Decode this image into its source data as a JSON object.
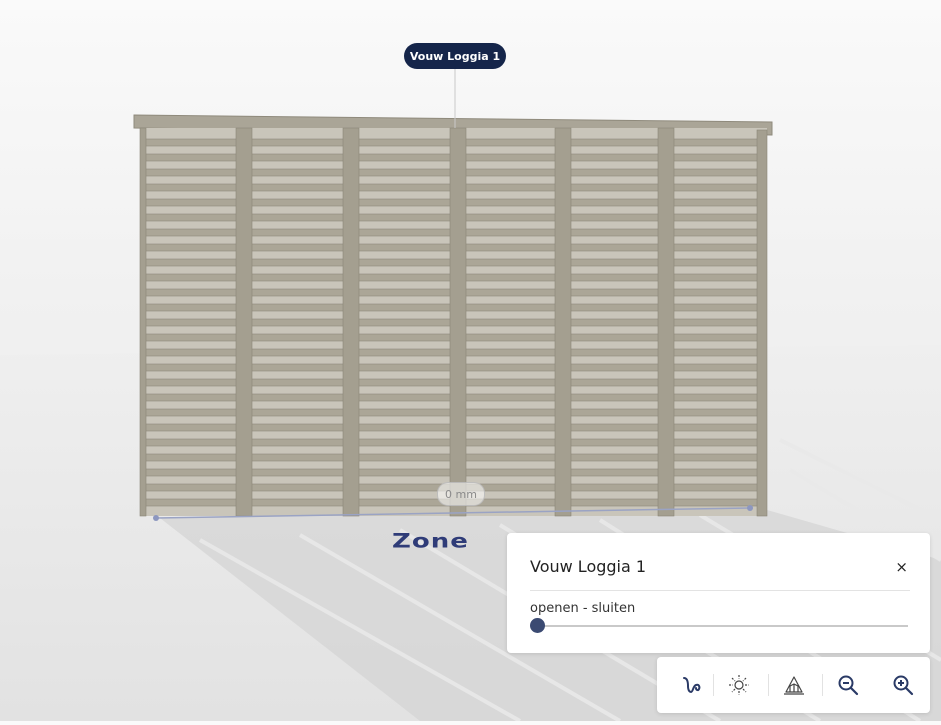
{
  "scene": {
    "object_tag": "Vouw Loggia 1",
    "measure_label": "0 mm",
    "zone_label": "Zone"
  },
  "panel": {
    "title": "Vouw Loggia 1",
    "close_label": "×",
    "slider_label": "openen - sluiten",
    "slider_value": 0
  },
  "toolbar": {
    "icons": [
      "curve-tool-icon",
      "sun-icon",
      "house-view-icon",
      "zoom-out-icon",
      "zoom-in-icon"
    ]
  },
  "colors": {
    "accent": "#15254a",
    "slat": "#a8a395",
    "frame": "#9a9484"
  }
}
